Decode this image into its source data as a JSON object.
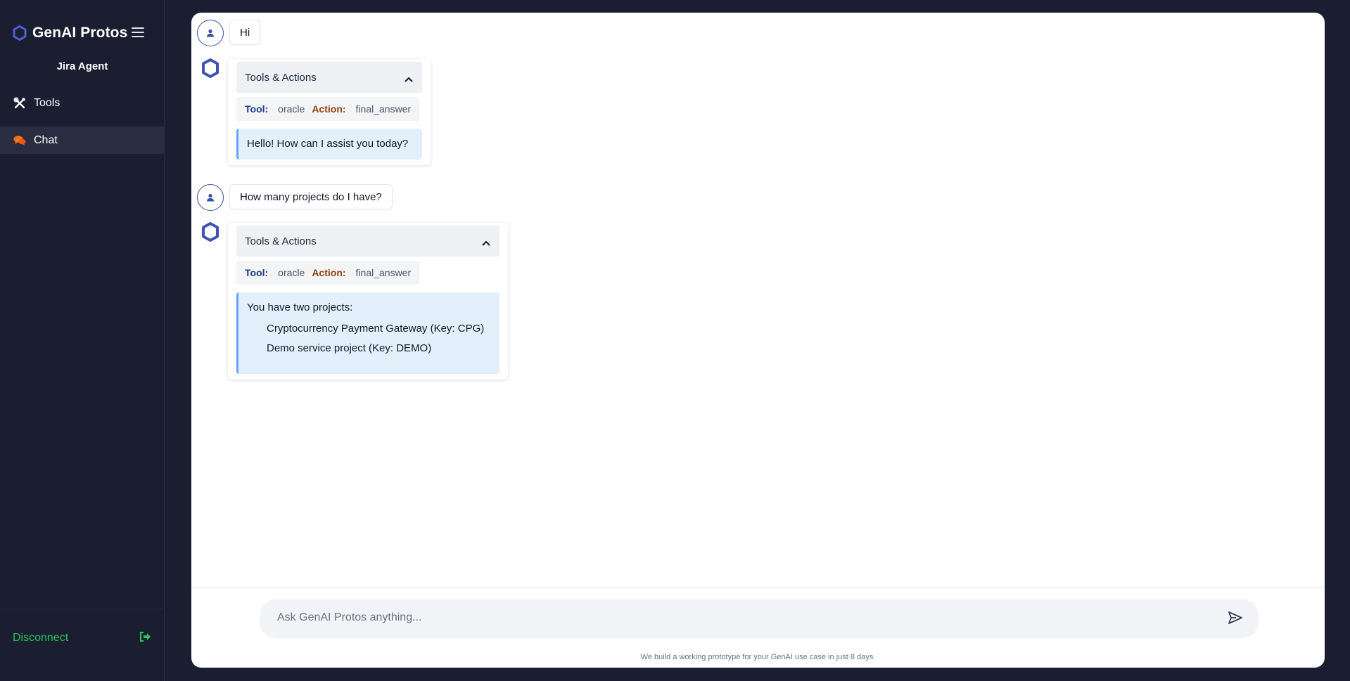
{
  "brand": {
    "name": "GenAI Protos"
  },
  "sidebar": {
    "agent_name": "Jira Agent",
    "items": [
      {
        "label": "Tools",
        "icon": "tools-icon"
      },
      {
        "label": "Chat",
        "icon": "chat-icon"
      }
    ],
    "disconnect_label": "Disconnect"
  },
  "chat": {
    "messages": [
      {
        "role": "user",
        "text": "Hi"
      },
      {
        "role": "assistant",
        "section_title": "Tools & Actions",
        "tool_label": "Tool:",
        "tool": "oracle",
        "action_label": "Action:",
        "action": "final_answer",
        "answer": "Hello! How can I assist you today?"
      },
      {
        "role": "user",
        "text": "How many projects do I have?"
      },
      {
        "role": "assistant",
        "section_title": "Tools & Actions",
        "tool_label": "Tool:",
        "tool": "oracle",
        "action_label": "Action:",
        "action": "final_answer",
        "answer_intro": "You have two projects:",
        "answer_items": [
          "Cryptocurrency Payment Gateway (Key: CPG)",
          "Demo service project (Key: DEMO)"
        ]
      }
    ]
  },
  "input": {
    "placeholder": "Ask GenAI Protos anything...",
    "value": ""
  },
  "footer": {
    "note": "We build a working prototype for your GenAI use case in just 8 days."
  },
  "colors": {
    "background": "#1b1d30",
    "accent_blue": "#3b4fa8",
    "chat_icon": "#f97316",
    "disconnect": "#22c55e",
    "answer_bg": "#e3effb"
  }
}
